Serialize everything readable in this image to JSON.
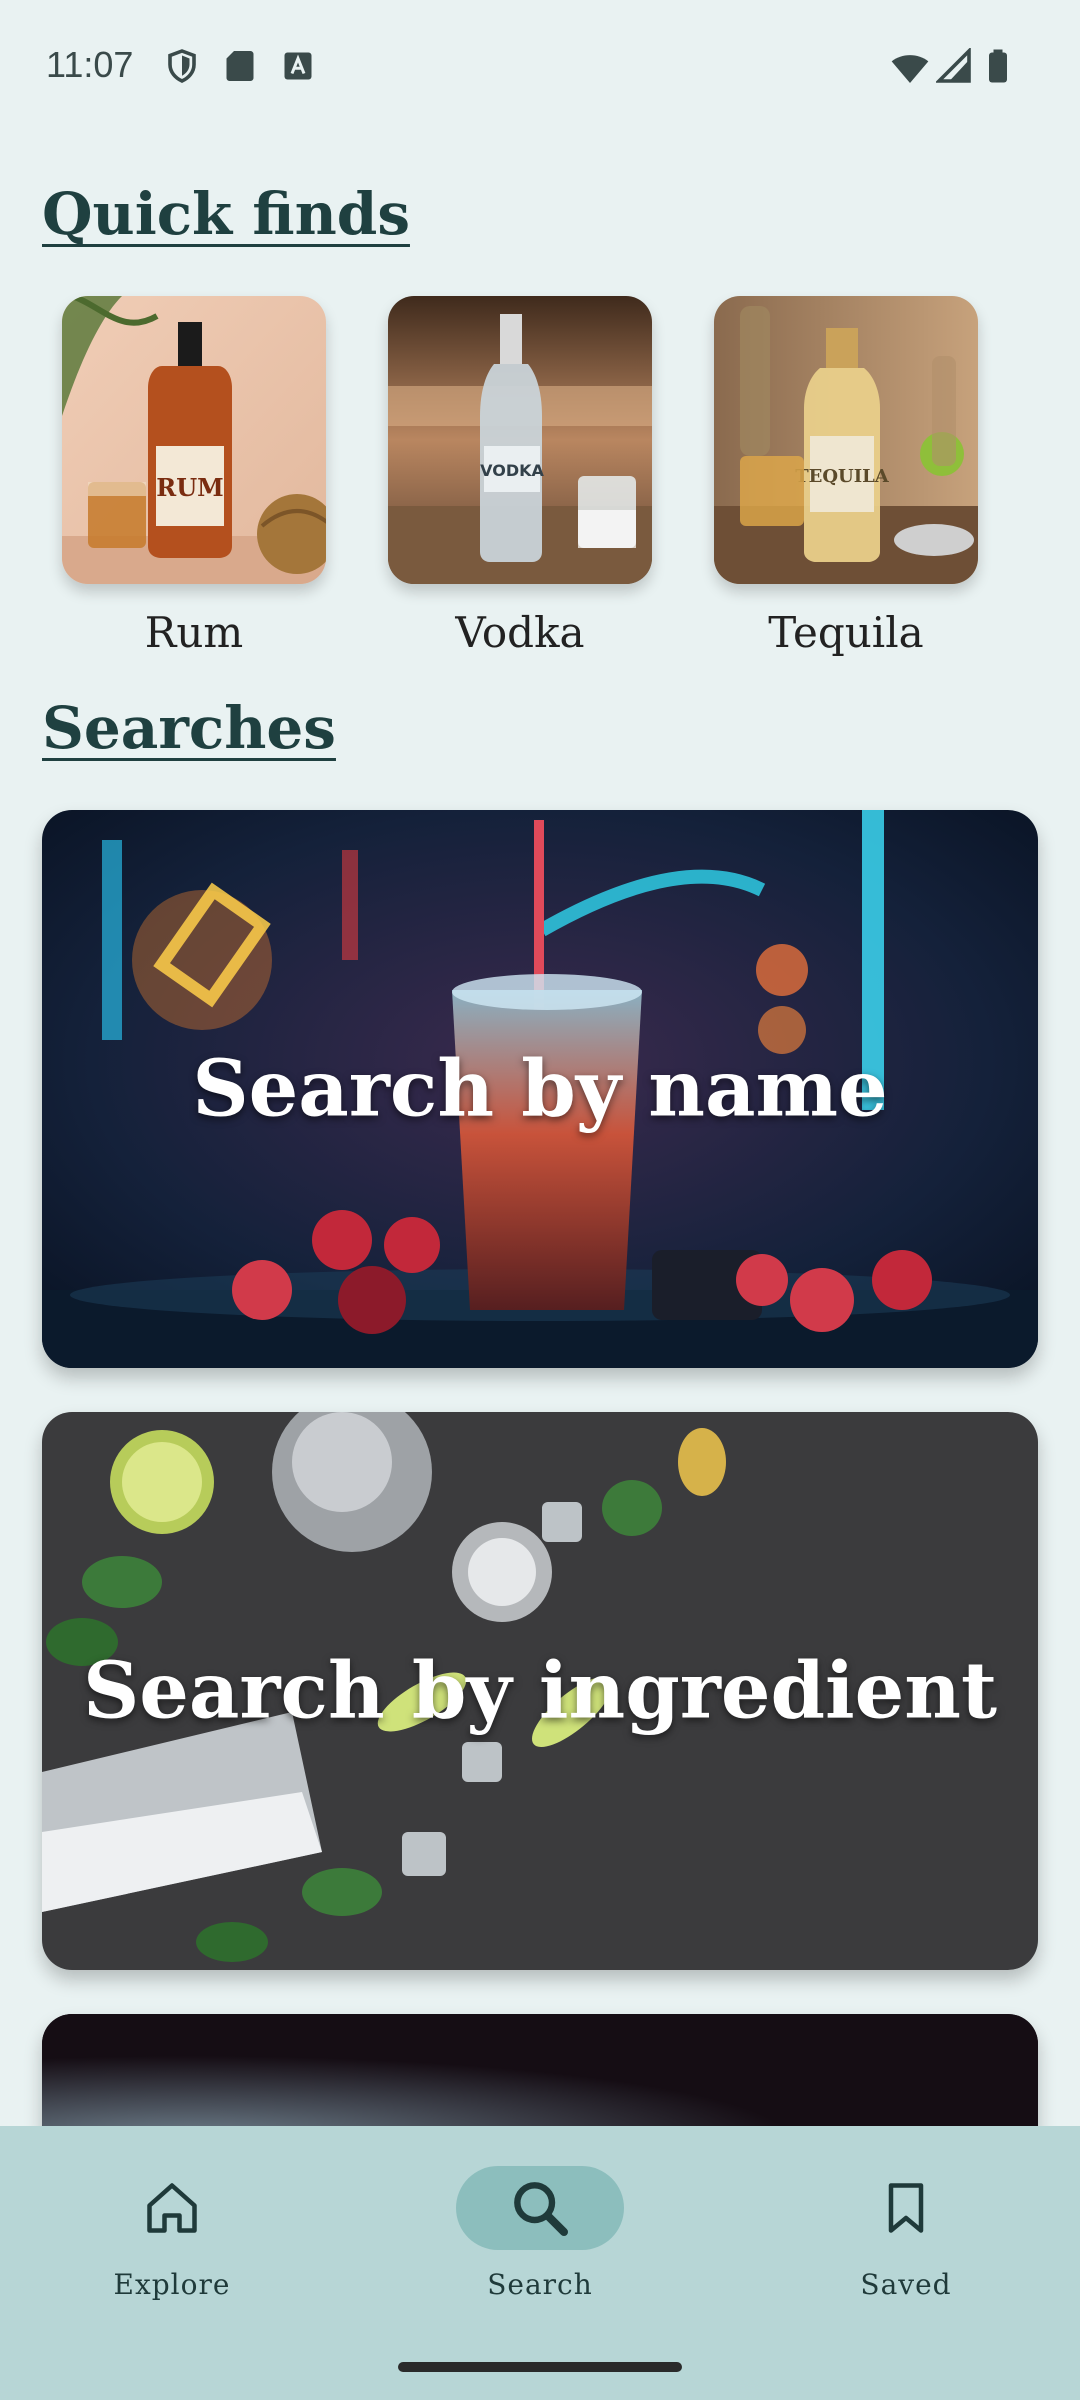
{
  "status": {
    "time": "11:07"
  },
  "quick_finds": {
    "title": "Quick finds",
    "items": [
      {
        "label": "Rum"
      },
      {
        "label": "Vodka"
      },
      {
        "label": "Tequila"
      }
    ]
  },
  "searches": {
    "title": "Searches",
    "cards": [
      {
        "title": "Search by name"
      },
      {
        "title": "Search by ingredient"
      }
    ]
  },
  "nav": {
    "items": [
      {
        "label": "Explore",
        "icon": "home-icon"
      },
      {
        "label": "Search",
        "icon": "search-icon",
        "active": true
      },
      {
        "label": "Saved",
        "icon": "bookmark-icon"
      }
    ]
  },
  "colors": {
    "background": "#e9f2f2",
    "heading": "#1f4040",
    "nav_bar": "#b7d6d6",
    "nav_active": "#8cbebd"
  }
}
